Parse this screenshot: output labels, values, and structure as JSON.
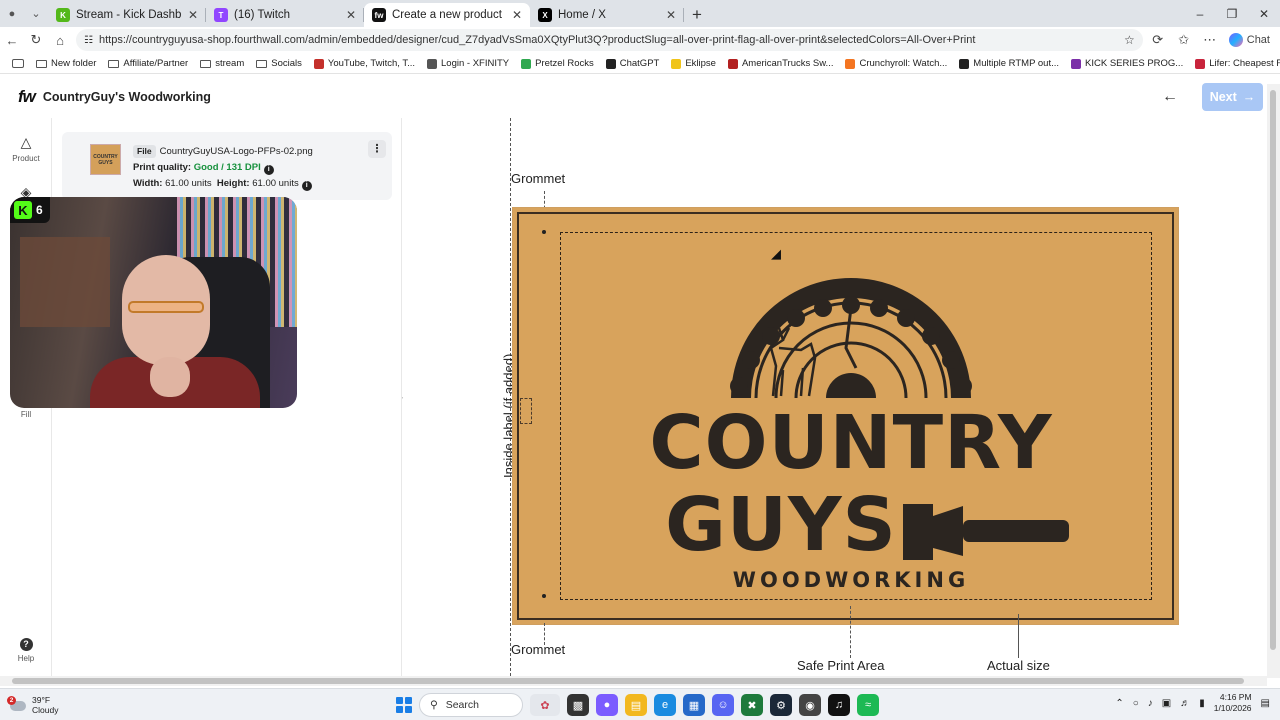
{
  "browser": {
    "tabs": [
      {
        "title": "Stream - Kick Dashboard",
        "fav": "K",
        "color": "#53b81a",
        "active": false
      },
      {
        "title": "(16) Twitch",
        "fav": "T",
        "color": "#9146ff",
        "active": false
      },
      {
        "title": "Create a new product | Fourthwall",
        "fav": "fw",
        "color": "#111111",
        "active": true
      },
      {
        "title": "Home / X",
        "fav": "X",
        "color": "#000000",
        "active": false
      }
    ],
    "url": "https://countryguyusa-shop.fourthwall.com/admin/embedded/designer/cud_Z7dyadVsSma0XQtyPlut3Q?productSlug=all-over-print-flag-all-over-print&selectedColors=All-Over+Print",
    "chat_label": "Chat"
  },
  "bookmarks": [
    {
      "label": "New folder",
      "kind": "folder"
    },
    {
      "label": "Affiliate/Partner",
      "kind": "folder"
    },
    {
      "label": "stream",
      "kind": "folder"
    },
    {
      "label": "Socials",
      "kind": "folder"
    },
    {
      "label": "YouTube, Twitch, T...",
      "kind": "site",
      "color": "#c4302b"
    },
    {
      "label": "Login - XFINITY",
      "kind": "site",
      "color": "#555555"
    },
    {
      "label": "Pretzel Rocks",
      "kind": "site",
      "color": "#2fa84f"
    },
    {
      "label": "ChatGPT",
      "kind": "site",
      "color": "#222222"
    },
    {
      "label": "Eklipse",
      "kind": "site",
      "color": "#f0c419"
    },
    {
      "label": "AmericanTrucks Sw...",
      "kind": "site",
      "color": "#b32020"
    },
    {
      "label": "Crunchyroll: Watch...",
      "kind": "site",
      "color": "#f47521"
    },
    {
      "label": "Multiple RTMP out...",
      "kind": "site",
      "color": "#222222"
    },
    {
      "label": "KICK SERIES PROG...",
      "kind": "site",
      "color": "#7b2fa8"
    },
    {
      "label": "Lifer: Cheapest Fo...",
      "kind": "site",
      "color": "#c8243c"
    }
  ],
  "app": {
    "logo": "fw",
    "shop_name": "CountryGuy's Woodworking",
    "next_label": "Next"
  },
  "rail": {
    "product_label": "Product",
    "fill_label": "Fill",
    "help_label": "Help"
  },
  "layer": {
    "chip": "File",
    "filename": "CountryGuyUSA-Logo-PFPs-02.png",
    "quality_label": "Print quality:",
    "quality_value": "Good / 131 DPI",
    "width_label": "Width:",
    "width_value": "61.00 units",
    "height_label": "Height:",
    "height_value": "61.00 units",
    "thumb_text": "COUNTRY GUYS"
  },
  "stream_overlay": {
    "viewer_count": "6"
  },
  "canvas": {
    "grommet_top": "Grommet",
    "grommet_bottom": "Grommet",
    "inside_label": "Inside label (if added)",
    "safe_area": "Safe Print Area",
    "actual_size": "Actual size",
    "flag_color": "#d8a35c",
    "logo": {
      "line1": "COUNTRY",
      "line2": "GUYS",
      "line3": "WOODWORKING"
    }
  },
  "taskbar": {
    "temperature": "39°F",
    "condition": "Cloudy",
    "weather_badge": "2",
    "search_label": "Search",
    "time": "4:16 PM",
    "date": "1/10/2026"
  }
}
